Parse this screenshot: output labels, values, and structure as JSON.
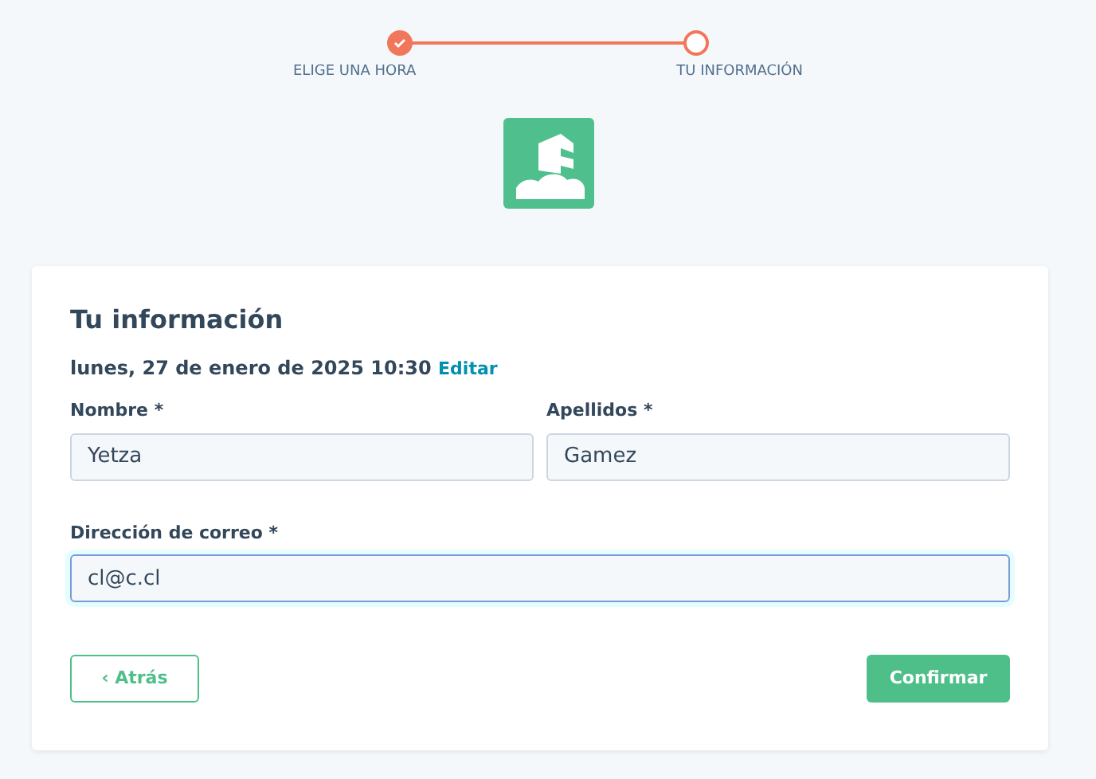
{
  "steps": [
    {
      "label": "ELIGE UNA HORA",
      "completed": true
    },
    {
      "label": "TU INFORMACIÓN",
      "completed": false
    }
  ],
  "form": {
    "title": "Tu información",
    "datetime": "lunes, 27 de enero de 2025 10:30",
    "edit_link": "Editar",
    "fields": [
      {
        "label": "Nombre *",
        "value": "Yetza",
        "focused": false
      },
      {
        "label": "Apellidos *",
        "value": "Gamez",
        "focused": false
      },
      {
        "label": "Dirección de correo *",
        "value": "cl@c.cl",
        "focused": true
      }
    ],
    "back_button": {
      "icon": "‹",
      "label": "Atrás"
    },
    "confirm_button": "Confirmar"
  }
}
